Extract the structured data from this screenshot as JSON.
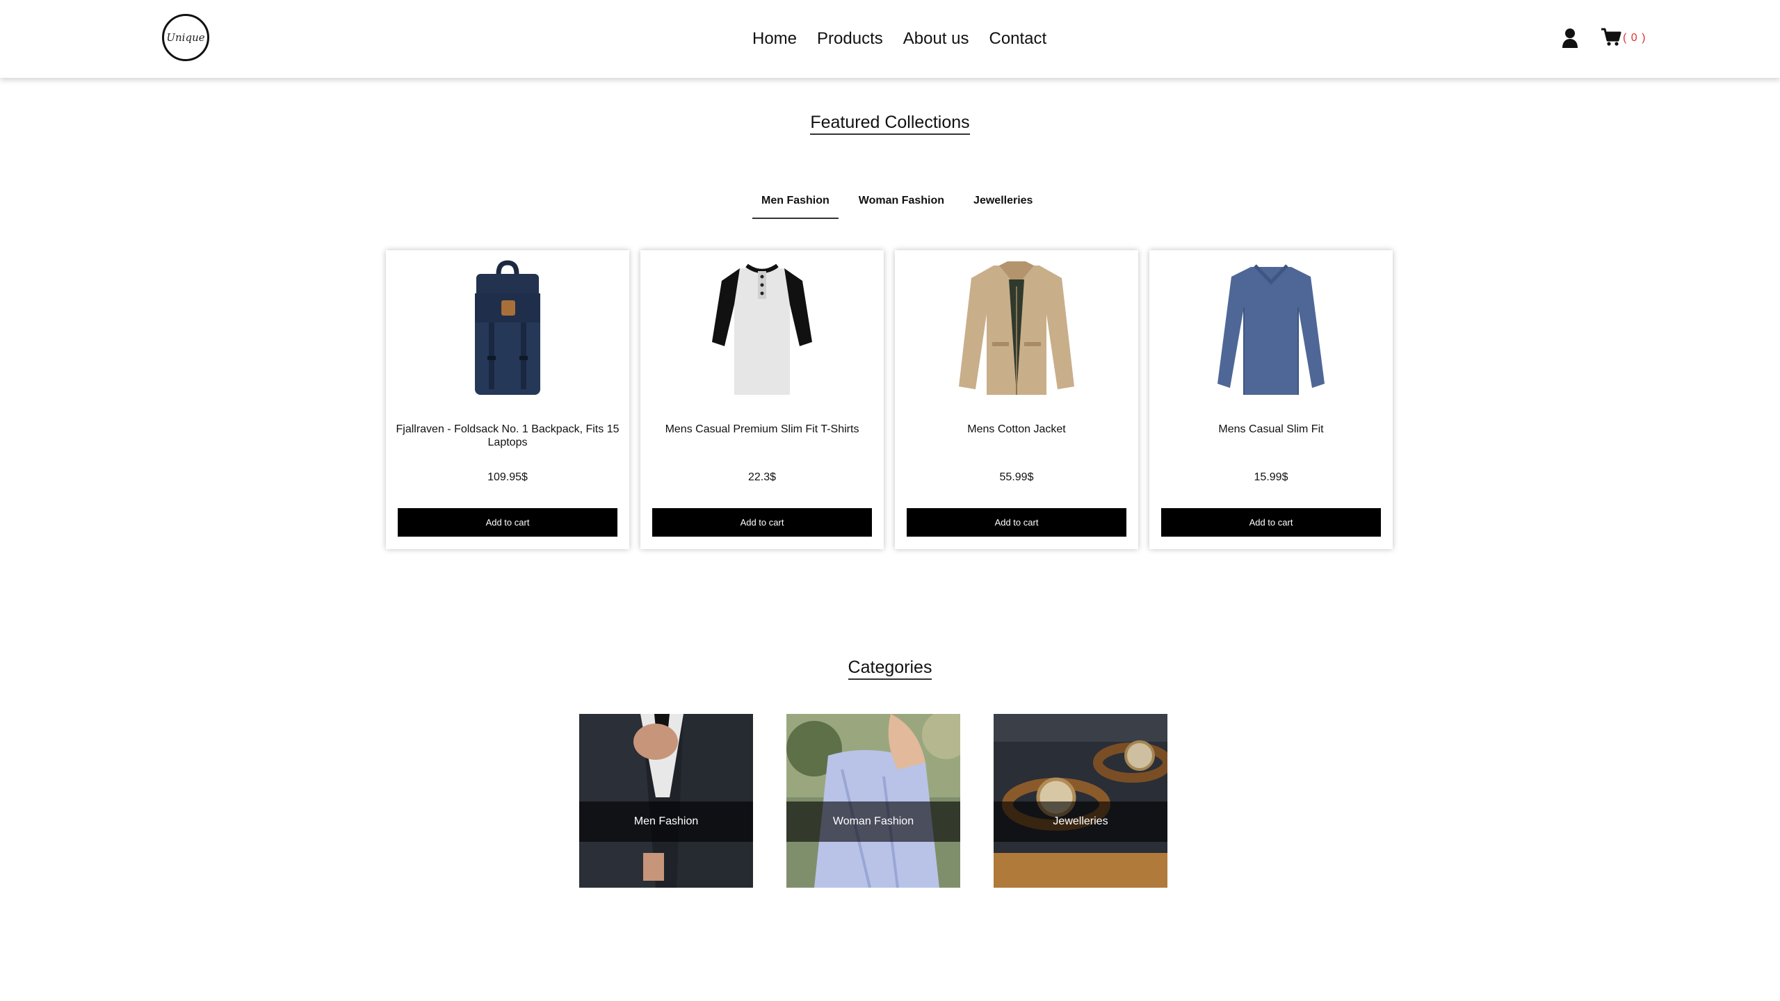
{
  "header": {
    "logo_text": "Unique",
    "nav": [
      "Home",
      "Products",
      "About us",
      "Contact"
    ],
    "cart_count": "( 0 )"
  },
  "featured": {
    "title": "Featured Collections",
    "tabs": [
      "Men Fashion",
      "Woman Fashion",
      "Jewelleries"
    ],
    "active_tab": "Men Fashion"
  },
  "products": [
    {
      "name": "Fjallraven - Foldsack No. 1 Backpack, Fits 15 Laptops",
      "price": "109.95$",
      "button": "Add to cart",
      "image": "backpack"
    },
    {
      "name": "Mens Casual Premium Slim Fit T-Shirts",
      "price": "22.3$",
      "button": "Add to cart",
      "image": "henley-shirt"
    },
    {
      "name": "Mens Cotton Jacket",
      "price": "55.99$",
      "button": "Add to cart",
      "image": "cotton-jacket"
    },
    {
      "name": "Mens Casual Slim Fit",
      "price": "15.99$",
      "button": "Add to cart",
      "image": "long-sleeve-tee"
    }
  ],
  "categories": {
    "title": "Categories",
    "items": [
      "Men Fashion",
      "Woman Fashion",
      "Jewelleries"
    ]
  },
  "icons": {
    "user": "user-icon",
    "cart": "cart-icon"
  },
  "colors": {
    "button_bg": "#000000",
    "cart_count": "#e03131",
    "backpack": "#22324f",
    "jacket": "#c9ae8a",
    "tee": "#4f6796"
  }
}
